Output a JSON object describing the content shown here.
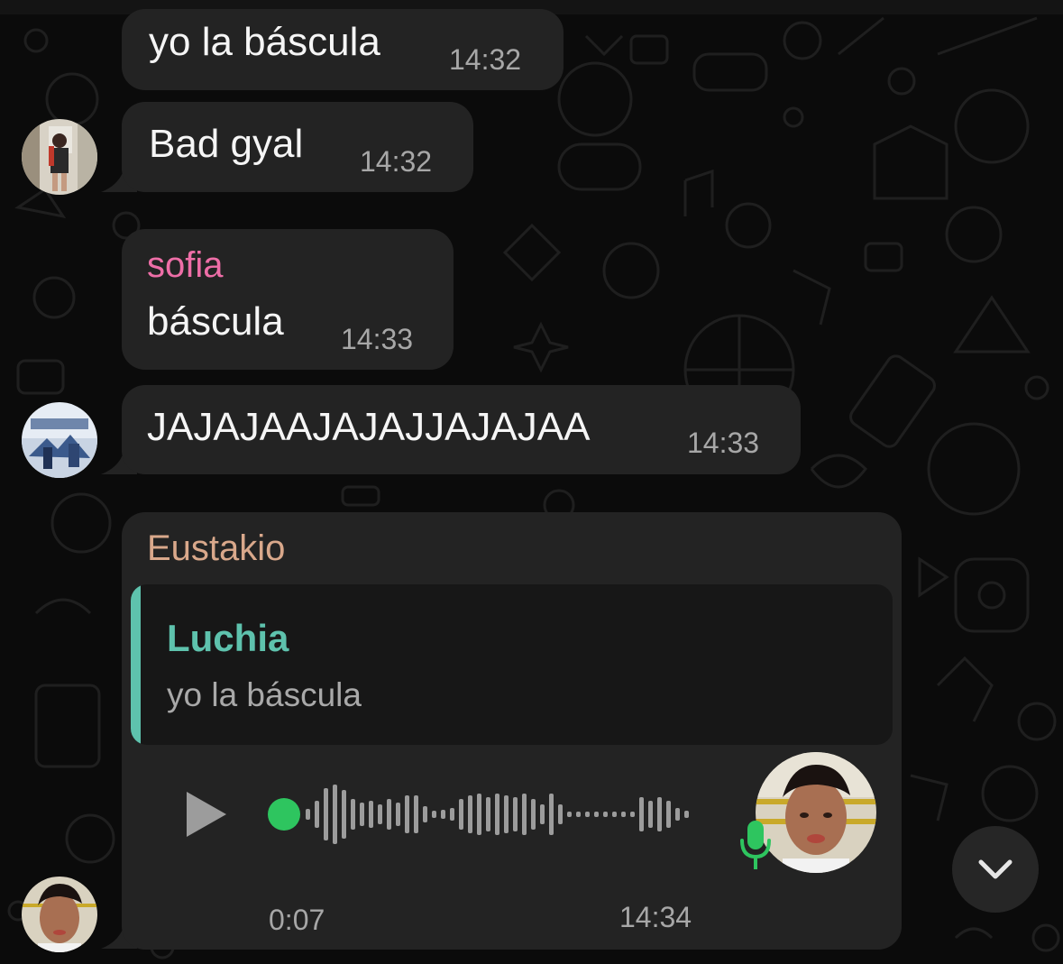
{
  "messages": [
    {
      "text": "yo la báscula",
      "time": "14:32"
    },
    {
      "text": "Bad gyal",
      "time": "14:32"
    },
    {
      "sender": "sofia",
      "sender_color": "#ee6ea7",
      "text": "báscula",
      "time": "14:33"
    },
    {
      "text": "JAJAJAAJAJAJJAJAJAA",
      "time": "14:33"
    }
  ],
  "voice_message": {
    "sender": "Eustakio",
    "sender_color": "#d9a88b",
    "reply": {
      "name": "Luchia",
      "text": "yo la báscula",
      "accent": "#5ec2ad"
    },
    "duration": "0:07",
    "time": "14:34",
    "played_fraction": 0,
    "mic_color": "#2ec55f",
    "progress_dot_color": "#2ec55f"
  },
  "icons": {
    "play": "play-icon",
    "mic": "microphone-icon",
    "scroll": "chevron-down-icon"
  },
  "colors": {
    "background": "#0b0b0b",
    "bubble": "#232323",
    "timestamp": "#a7a7a7"
  }
}
